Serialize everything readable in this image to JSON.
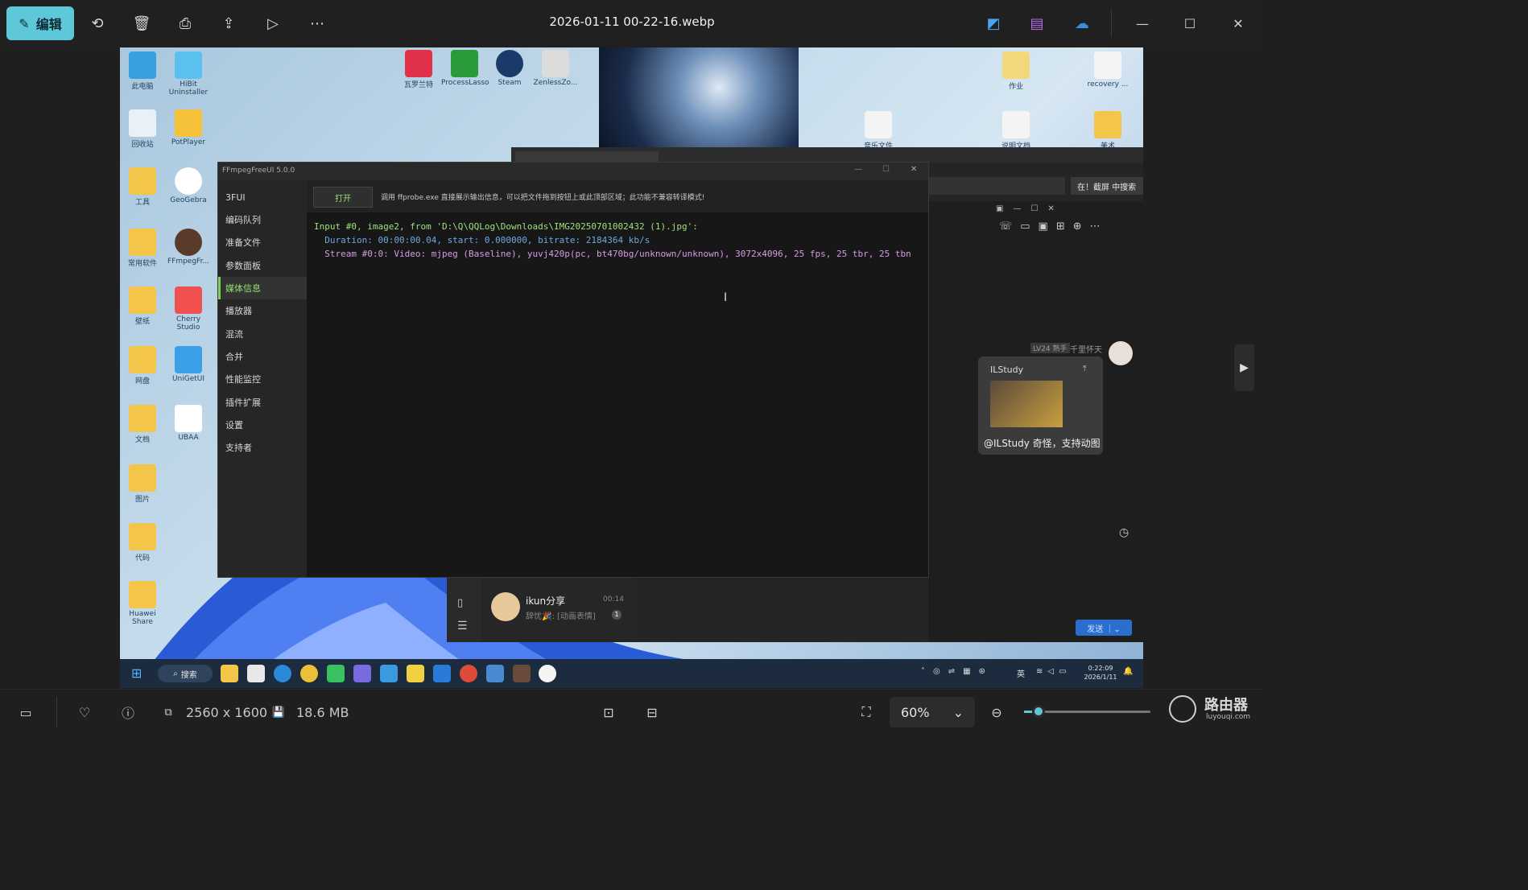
{
  "toolbar": {
    "edit_label": "编辑",
    "file_title": "2026-01-11 00-22-16.webp"
  },
  "desktop": {
    "icons": [
      "此电脑",
      "HiBit Uninstaller",
      "回收站",
      "PotPlayer",
      "工具",
      "GeoGebra",
      "常用软件",
      "FFmpegFr...",
      "壁纸",
      "Cherry Studio",
      "网盘",
      "UniGetUI",
      "文档",
      "UBAA",
      "图片",
      "代码",
      "Huawei Share",
      "瓦罗兰特",
      "ProcessLasso",
      "Steam",
      "ZenlessZo...",
      "作业",
      "recovery ...",
      "音乐文件名.txt",
      "说明文档",
      "美术"
    ]
  },
  "ffmpeg": {
    "title": "FFmpegFreeUI 5.0.0",
    "nav": [
      "3FUI",
      "编码队列",
      "准备文件",
      "参数面板",
      "媒体信息",
      "播放器",
      "混流",
      "合并",
      "性能监控",
      "插件扩展",
      "设置",
      "支持者"
    ],
    "open_label": "打开",
    "hint": "调用 ffprobe.exe 直接展示输出信息，可以把文件拖到按钮上或此顶部区域；此功能不兼容转译模式!",
    "output": [
      "Input #0, image2, from 'D:\\Q\\QQLog\\Downloads\\IMG20250701002432 (1).jpg':",
      "  Duration: 00:00:00.04, start: 0.000000, bitrate: 2184364 kb/s",
      "  Stream #0:0: Video: mjpeg (Baseline), yuvj420p(pc, bt470bg/unknown/unknown), 3072x4096, 25 fps, 25 tbr, 25 tbn"
    ],
    "colors": {
      "line1": "#9fe27a",
      "line2": "#6fa8e0",
      "line3": "#d89ae6"
    }
  },
  "qq": {
    "search_label": "在！截屏 中搜索",
    "sender_badge": "LV24 熟手",
    "sender_name": "千里怀天",
    "card_title": "ILStudy",
    "message": "@ILStudy 奇怪，支持动图",
    "chat_name": "ikun分享",
    "chat_time": "00:14",
    "chat_preview": "辞忧🎉: [动画表情]",
    "chat_unread": "1",
    "send_label": "发送"
  },
  "taskbar": {
    "search_label": "搜索",
    "lang": "英",
    "time": "0:22:09",
    "date": "2026/1/11"
  },
  "bottom": {
    "dimensions": "2560 x 1600",
    "filesize": "18.6 MB",
    "zoom": "60%",
    "zoom_fraction": 0.06
  },
  "watermark": {
    "name": "路由器",
    "site": "luyouqi.com"
  }
}
